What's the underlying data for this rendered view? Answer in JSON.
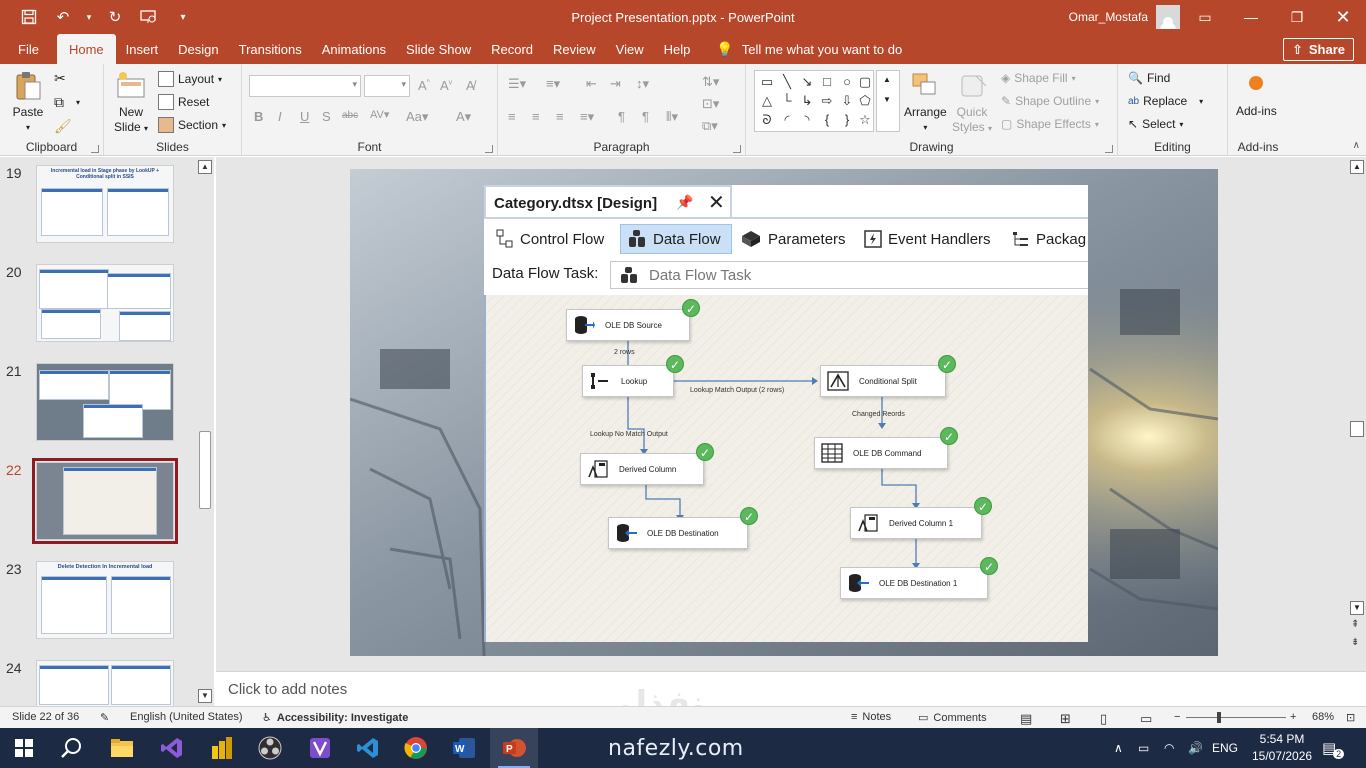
{
  "app": {
    "doc_title": "Project Presentation.pptx  -  PowerPoint",
    "user": "Omar_Mostafa"
  },
  "menu": {
    "tabs": [
      "File",
      "Home",
      "Insert",
      "Design",
      "Transitions",
      "Animations",
      "Slide Show",
      "Record",
      "Review",
      "View",
      "Help"
    ],
    "tell_me": "Tell me what you want to do",
    "share": "Share"
  },
  "ribbon": {
    "clipboard": {
      "label": "Clipboard",
      "paste": "Paste"
    },
    "slides": {
      "label": "Slides",
      "new_slide_1": "New",
      "new_slide_2": "Slide",
      "layout": "Layout",
      "reset": "Reset",
      "section": "Section"
    },
    "font": {
      "label": "Font"
    },
    "paragraph": {
      "label": "Paragraph"
    },
    "drawing": {
      "label": "Drawing",
      "arrange": "Arrange",
      "quick_styles_1": "Quick",
      "quick_styles_2": "Styles",
      "shape_fill": "Shape Fill",
      "shape_outline": "Shape Outline",
      "shape_effects": "Shape Effects"
    },
    "editing": {
      "label": "Editing",
      "find": "Find",
      "replace": "Replace",
      "select": "Select"
    },
    "addins": {
      "label": "Add-ins",
      "button": "Add-ins"
    }
  },
  "thumbnails": [
    {
      "num": "19",
      "title": "Incremental load in Stage phase by LookUP + Conditional split in SSIS"
    },
    {
      "num": "20",
      "title": ""
    },
    {
      "num": "21",
      "title": ""
    },
    {
      "num": "22",
      "title": ""
    },
    {
      "num": "23",
      "title": "Delete Detection In Incremental load"
    },
    {
      "num": "24",
      "title": ""
    }
  ],
  "ssis": {
    "doc_tab": "Category.dtsx [Design]",
    "tabs": [
      "Control Flow",
      "Data Flow",
      "Parameters",
      "Event Handlers",
      "Packag"
    ],
    "task_label": "Data Flow Task:",
    "task_value": "Data Flow Task",
    "nodes": {
      "ole_source": "OLE DB Source",
      "lookup": "Lookup",
      "cond_split": "Conditional Split",
      "derived": "Derived Column",
      "ole_command": "OLE DB Command",
      "ole_dest": "OLE DB Destination",
      "derived1": "Derived Column 1",
      "ole_dest1": "OLE DB Destination 1"
    },
    "paths": {
      "rows": "2 rows",
      "match": "Lookup Match Output (2 rows)",
      "changed": "Changed Reords",
      "no_match": "Lookup No Match Output"
    }
  },
  "notes": {
    "placeholder": "Click to add notes"
  },
  "status": {
    "slide": "Slide 22 of 36",
    "language": "English (United States)",
    "accessibility": "Accessibility: Investigate",
    "notes": "Notes",
    "comments": "Comments",
    "zoom": "68%"
  },
  "taskbar": {
    "brand": "nafezly.com",
    "lang": "ENG",
    "time": "5:54 PM",
    "date": "15/07/2026",
    "notif_count": "2"
  },
  "watermark": "نفذلي",
  "colors": {
    "accent": "#b7472a",
    "selected_thumb": "#8b1c24",
    "check": "#5cb85c"
  }
}
